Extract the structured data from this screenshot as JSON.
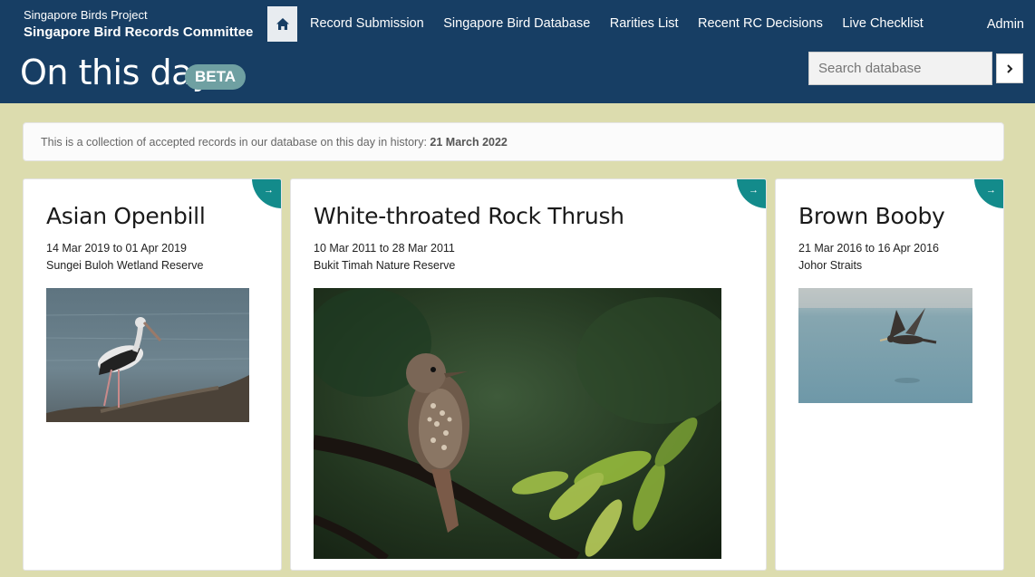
{
  "header": {
    "brand_sub": "Singapore Birds Project",
    "brand_main": "Singapore Bird Records Committee",
    "nav": [
      "Record Submission",
      "Singapore Bird Database",
      "Rarities List",
      "Recent RC Decisions",
      "Live Checklist"
    ],
    "admin": "Admin",
    "title": "On this day",
    "badge": "BETA",
    "search_placeholder": "Search database",
    "home_icon": "home-icon",
    "search_icon": "chevron-right-icon"
  },
  "info": {
    "text": "This is a collection of accepted records in our database on this day in history: ",
    "date": "21 March 2022"
  },
  "cards": [
    {
      "name": "Asian Openbill",
      "dates": "14 Mar 2019 to 01 Apr 2019",
      "location": "Sungei Buloh Wetland Reserve",
      "arrow": "→"
    },
    {
      "name": "White-throated Rock Thrush",
      "dates": "10 Mar 2011 to 28 Mar 2011",
      "location": "Bukit Timah Nature Reserve",
      "arrow": "→"
    },
    {
      "name": "Brown Booby",
      "dates": "21 Mar 2016 to 16 Apr 2016",
      "location": "Johor Straits",
      "arrow": "→"
    }
  ],
  "colors": {
    "header_bg": "#173e64",
    "page_bg": "#dcdcae",
    "accent": "#138b8b",
    "badge": "#6fa0a2"
  }
}
